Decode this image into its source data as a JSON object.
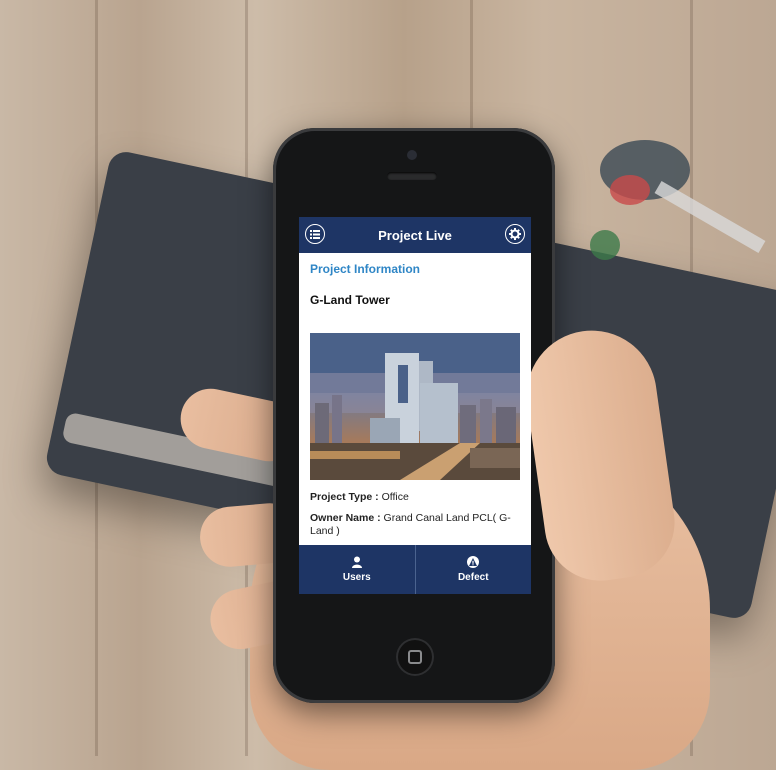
{
  "app": {
    "title": "Project Live",
    "header_left_icon": "menu-list-icon",
    "header_right_icon": "gear-icon"
  },
  "content": {
    "section_title": "Project Information",
    "project_name": "G-Land Tower",
    "project_type_label": "Project Type :",
    "project_type_value": "Office",
    "owner_label": "Owner Name :",
    "owner_value": "Grand Canal Land PCL( G-Land )"
  },
  "tabs": [
    {
      "label": "Users",
      "icon": "user-icon"
    },
    {
      "label": "Defect",
      "icon": "warning-icon"
    }
  ],
  "colors": {
    "header_bg": "#1e3565",
    "accent": "#2f86c6"
  }
}
